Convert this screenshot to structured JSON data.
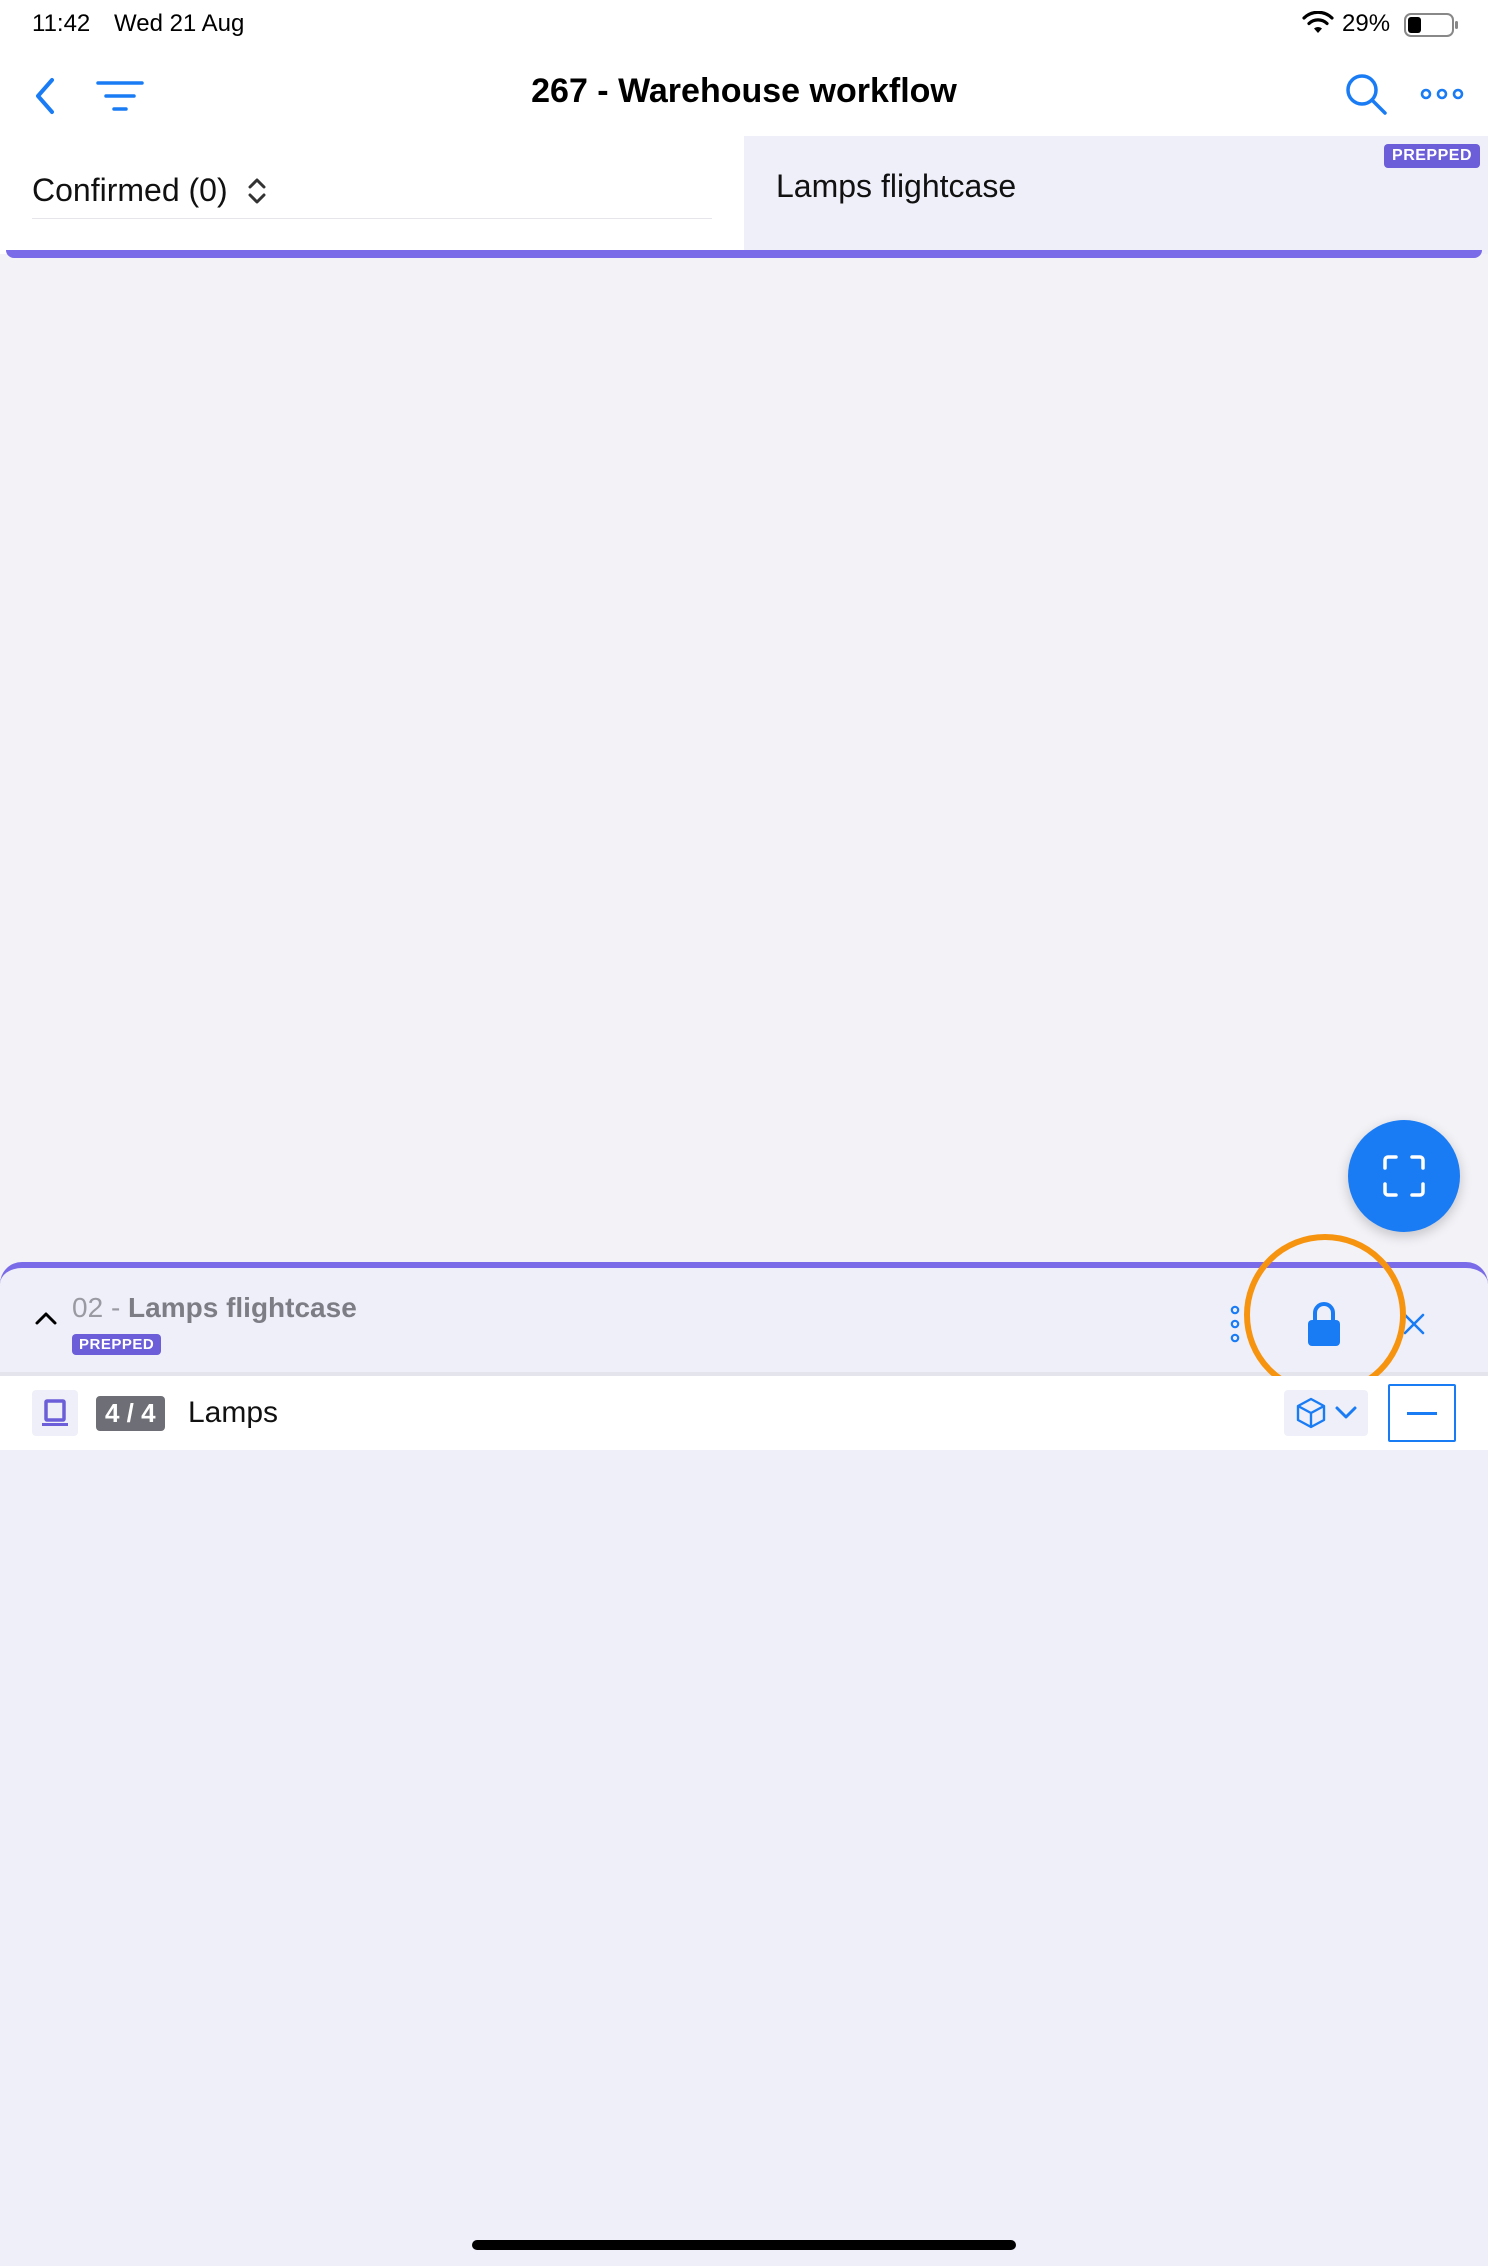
{
  "status_bar": {
    "time": "11:42",
    "date": "Wed 21 Aug",
    "battery": "29%"
  },
  "nav": {
    "title": "267 - Warehouse workflow",
    "icons": [
      "chevron-left-icon",
      "filter-icon",
      "search-icon",
      "ellipsis-icon"
    ]
  },
  "top_panel": {
    "status_filter": "Confirmed (0)",
    "selected_case": "Lamps flightcase",
    "case_badge": "PREPPED"
  },
  "sheet": {
    "number": "02",
    "separator": "-",
    "name": "Lamps flightcase",
    "badge": "PREPPED",
    "items": [
      {
        "quantity": "4 / 4",
        "name": "Lamps"
      }
    ]
  },
  "colors": {
    "accent_blue": "#1a7cf5",
    "badge_purple": "#6b5ed8",
    "highlight_orange": "#f7940f"
  }
}
